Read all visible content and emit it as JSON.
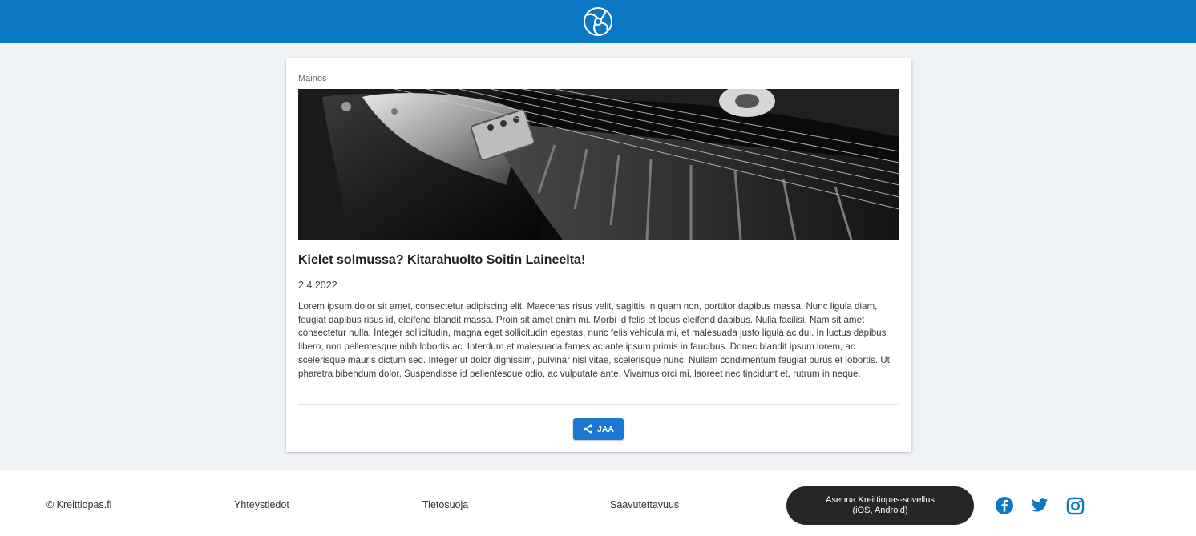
{
  "header": {
    "logo_icon": "record-adapter-logo-icon",
    "bg_color": "#0a78c2"
  },
  "article": {
    "ad_label": "Mainos",
    "image_icon": "electric-guitar-photo",
    "title": "Kielet solmussa? Kitarahuolto Soitin Laineelta!",
    "date": "2.4.2022",
    "body": "Lorem ipsum dolor sit amet, consectetur adipiscing elit. Maecenas risus velit, sagittis in quam non, porttitor dapibus massa. Nunc ligula diam, feugiat dapibus risus id, eleifend blandit massa. Proin sit amet enim mi. Morbi id felis et lacus eleifend dapibus. Nulla facilisi. Nam sit amet consectetur nulla. Integer sollicitudin, magna eget sollicitudin egestas, nunc felis vehicula mi, et malesuada justo ligula ac dui. In luctus dapibus libero, non pellentesque nibh lobortis ac. Interdum et malesuada fames ac ante ipsum primis in faucibus. Donec blandit ipsum lorem, ac scelerisque mauris dictum sed. Integer ut dolor dignissim, pulvinar nisl vitae, scelerisque nunc. Nullam condimentum feugiat purus et lobortis. Ut pharetra bibendum dolor. Suspendisse id pellentesque odio, ac vulputate ante. Vivamus orci mi, laoreet nec tincidunt et, rutrum in neque.",
    "share_label": "JAA",
    "share_icon": "share-icon",
    "accent_color": "#1a78d2"
  },
  "footer": {
    "copyright": "© Kreittiopas.fi",
    "links": [
      "Yhteystiedot",
      "Tietosuoja",
      "Saavutettavuus"
    ],
    "app_button": {
      "line1": "Asenna Kreittiopas-sovellus",
      "line2": "(iOS, Android)"
    },
    "social_icons": [
      "facebook-icon",
      "twitter-icon",
      "instagram-icon"
    ],
    "social_color": "#0a78c2"
  }
}
